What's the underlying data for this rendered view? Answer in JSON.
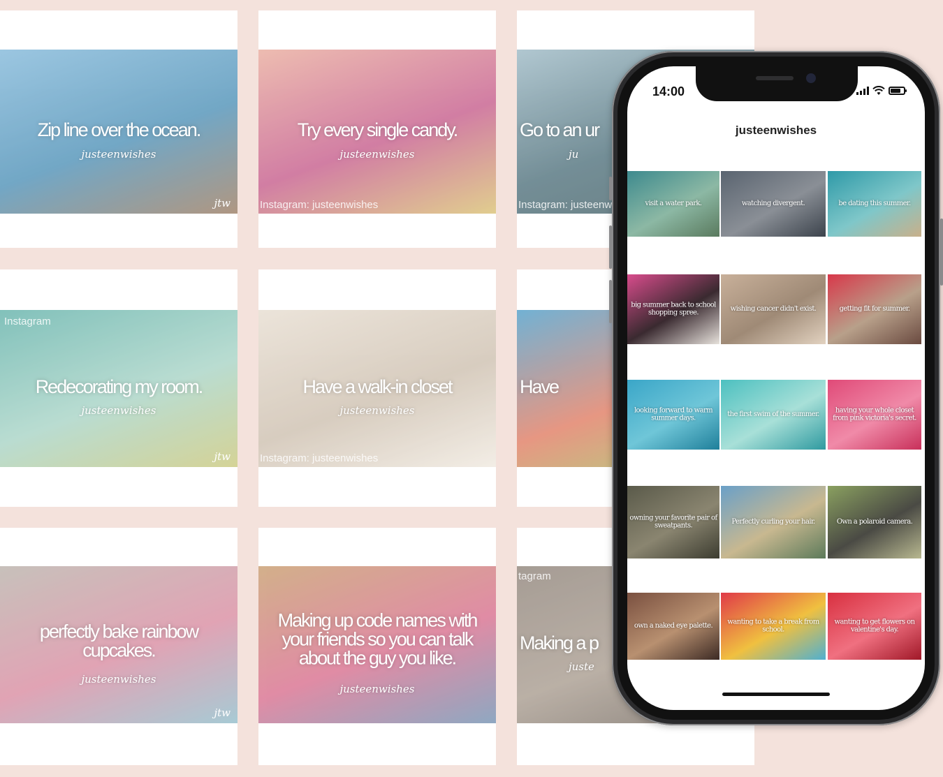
{
  "collage": [
    {
      "caption": "Zip line over the ocean.",
      "signature": "justeenwishes",
      "watermark": "jtw",
      "instagram": "",
      "colors": [
        "#7fb6d8",
        "#4b8fb6",
        "#9a7a5f"
      ]
    },
    {
      "caption": "Try every single candy.",
      "signature": "justeenwishes",
      "watermark": "",
      "instagram": "Instagram: justeenwishes",
      "colors": [
        "#e8a99a",
        "#c55a8a",
        "#d9c070"
      ]
    },
    {
      "caption": "Go to an ur",
      "signature": "ju",
      "watermark": "",
      "instagram": "Instagram: justeenw",
      "colors": [
        "#9ab7c3",
        "#4d6f7a",
        "#3f5a5f"
      ]
    },
    {
      "caption": "Redecorating my room.",
      "signature": "justeenwishes",
      "watermark": "jtw",
      "instagram": "Instagram",
      "colors": [
        "#5fb0a8",
        "#a6d3c5",
        "#c9c77a"
      ]
    },
    {
      "caption": "Have a walk-in closet",
      "signature": "justeenwishes",
      "watermark": "",
      "instagram": "Instagram: justeenwishes",
      "colors": [
        "#e6dccf",
        "#cdbfae",
        "#f0e9df"
      ]
    },
    {
      "caption": "Have",
      "signature": "",
      "watermark": "",
      "instagram": "",
      "colors": [
        "#4a9bc7",
        "#e07a60",
        "#9cc35a"
      ]
    },
    {
      "caption": "perfectly bake rainbow cupcakes.",
      "signature": "justeenwishes",
      "watermark": "jtw",
      "instagram": "",
      "colors": [
        "#b8b0a8",
        "#d98aa0",
        "#8fbcc9"
      ]
    },
    {
      "caption": "Making up code names with your friends so you can talk about the guy you like.",
      "signature": "justeenwishes",
      "watermark": "",
      "instagram": "",
      "colors": [
        "#c69a6a",
        "#d86c8c",
        "#6f8fb0"
      ]
    },
    {
      "caption": "Making a p",
      "signature": "juste",
      "watermark": "",
      "instagram": "tagram",
      "colors": [
        "#8d8177",
        "#a79a8d",
        "#6d635a"
      ]
    }
  ],
  "phone": {
    "time": "14:00",
    "profile_name": "justeenwishes",
    "feed": [
      {
        "caption": "visit a water park.",
        "colors": [
          "#3d8a8e",
          "#8cb8a4",
          "#5a7a5e"
        ]
      },
      {
        "caption": "watching divergent.",
        "colors": [
          "#5a6470",
          "#8a8f96",
          "#3c434c"
        ]
      },
      {
        "caption": "be dating this summer.",
        "colors": [
          "#2f9aa8",
          "#7fc7c9",
          "#c9b08a"
        ]
      },
      {
        "caption": "big summer back to school shopping spree.",
        "colors": [
          "#d84c8c",
          "#3a2a30",
          "#e7e2dc"
        ]
      },
      {
        "caption": "wishing cancer didn't exist.",
        "colors": [
          "#c8b09a",
          "#9f8a76",
          "#e2d2c0"
        ]
      },
      {
        "caption": "getting fit for summer.",
        "colors": [
          "#d8384a",
          "#b8a08a",
          "#6a4a40"
        ]
      },
      {
        "caption": "looking forward to warm summer days.",
        "colors": [
          "#3aa6c8",
          "#6fc6d8",
          "#1f7f9a"
        ]
      },
      {
        "caption": "the first swim of the summer.",
        "colors": [
          "#4cc0c0",
          "#a8e0d8",
          "#2f9aa0"
        ]
      },
      {
        "caption": "having your whole closet from pink victoria's secret.",
        "colors": [
          "#e04a78",
          "#f08aa8",
          "#c8305a"
        ]
      },
      {
        "caption": "owning your favorite pair of sweatpants.",
        "colors": [
          "#5a5a4a",
          "#8a8570",
          "#3c3c30"
        ]
      },
      {
        "caption": "Perfectly curling your hair.",
        "colors": [
          "#6aa0c8",
          "#c8b890",
          "#5c7a5a"
        ]
      },
      {
        "caption": "Own a polaroid camera.",
        "colors": [
          "#8aa060",
          "#4a4a44",
          "#b8b890"
        ]
      },
      {
        "caption": "own a naked eye palette.",
        "colors": [
          "#7a5040",
          "#b89070",
          "#3c2a24"
        ]
      },
      {
        "caption": "wanting to take a break from school.",
        "colors": [
          "#e03a48",
          "#f0c040",
          "#50b0d0"
        ]
      },
      {
        "caption": "wanting to get flowers on valentine's day.",
        "colors": [
          "#d83040",
          "#f07080",
          "#a01828"
        ]
      }
    ]
  }
}
